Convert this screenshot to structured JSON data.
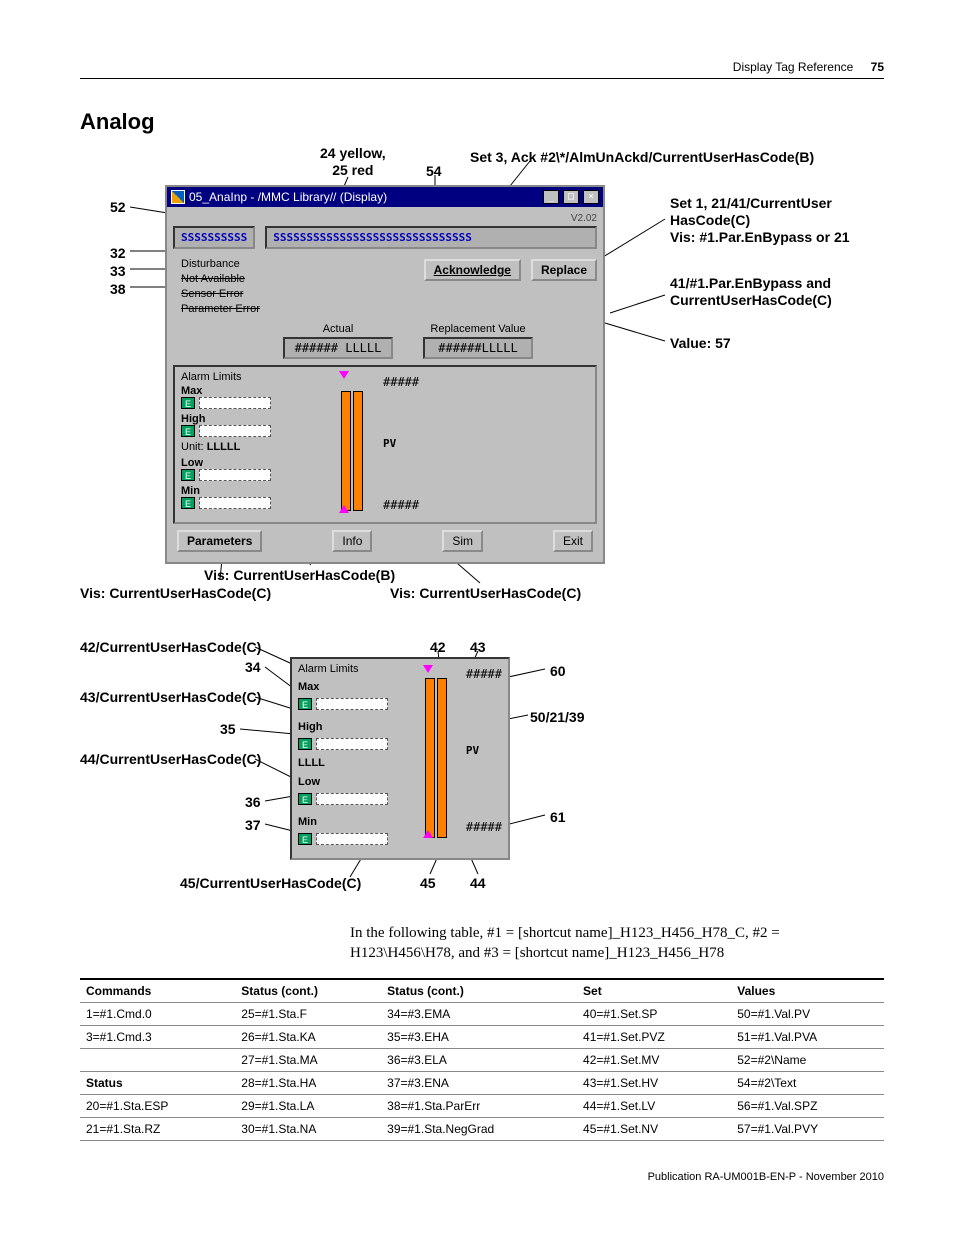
{
  "header": {
    "section": "Display Tag Reference",
    "page": "75"
  },
  "title": "Analog",
  "fig1": {
    "callouts": {
      "c24": "24 yellow,\n25 red",
      "c54": "54",
      "cSet3": "Set 3, Ack #2\\*/AlmUnAckd/CurrentUserHasCode(B)",
      "c52": "52",
      "c32": "32",
      "c33": "33",
      "c38": "38",
      "cSet1": "Set 1, 21/41/CurrentUser\nHasCode(C)\nVis: #1.Par.EnBypass or 21",
      "c41": "41/#1.Par.EnBypass and\nCurrentUserHasCode(C)",
      "c57": "Value: 57",
      "visC_1": "Vis: CurrentUserHasCode(C)",
      "visB": "Vis: CurrentUserHasCode(B)",
      "visC_2": "Vis: CurrentUserHasCode(C)"
    },
    "dialog": {
      "title": "05_AnaInp - /MMC Library// (Display)",
      "version": "V2.02",
      "field_s1": "SSSSSSSSSS",
      "field_s2": "SSSSSSSSSSSSSSSSSSSSSSSSSSSSSS",
      "status": {
        "disturbance": "Disturbance",
        "not_available": "Not Available",
        "sensor_error": "Sensor Error",
        "parameter_error": "Parameter Error"
      },
      "btn_ack": "Acknowledge",
      "btn_replace": "Replace",
      "lbl_actual": "Actual",
      "lbl_repl": "Replacement Value",
      "val_actual": "###### LLLLL",
      "val_repl": "######LLLLL",
      "alarm_title": "Alarm Limits",
      "max": "Max",
      "high": "High",
      "low": "Low",
      "min": "Min",
      "hash": "#####",
      "unit_lbl": "Unit:",
      "unit_val": "LLLLL",
      "pv": "PV",
      "btn_params": "Parameters",
      "btn_info": "Info",
      "btn_sim": "Sim",
      "btn_exit": "Exit"
    }
  },
  "fig2": {
    "callouts": {
      "c42c": "42/CurrentUserHasCode(C)",
      "c43c": "43/CurrentUserHasCode(C)",
      "c44c": "44/CurrentUserHasCode(C)",
      "c45c": "45/CurrentUserHasCode(C)",
      "c34": "34",
      "c35": "35",
      "c36": "36",
      "c37": "37",
      "c42": "42",
      "c43": "43",
      "c60": "60",
      "c61": "61",
      "c50": "50/21/39",
      "c45": "45",
      "c44": "44"
    },
    "panel": {
      "title": "Alarm Limits",
      "max": "Max",
      "high": "High",
      "low": "Low",
      "min": "Min",
      "llll": "LLLL",
      "hash": "#####",
      "pv": "PV"
    }
  },
  "caption": "In the following table, #1 = [shortcut name]_H123_H456_H78_C, #2 = H123\\H456\\H78, and #3 = [shortcut name]_H123_H456_H78",
  "table": {
    "headers": [
      "Commands",
      "Status (cont.)",
      "Status (cont.)",
      "Set",
      "Values"
    ],
    "rows": [
      [
        "1=#1.Cmd.0",
        "25=#1.Sta.F",
        "34=#3.EMA",
        "40=#1.Set.SP",
        "50=#1.Val.PV"
      ],
      [
        "3=#1.Cmd.3",
        "26=#1.Sta.KA",
        "35=#3.EHA",
        "41=#1.Set.PVZ",
        "51=#1.Val.PVA"
      ],
      [
        "",
        "27=#1.Sta.MA",
        "36=#3.ELA",
        "42=#1.Set.MV",
        "52=#2\\Name"
      ],
      [
        "__Status",
        "28=#1.Sta.HA",
        "37=#3.ENA",
        "43=#1.Set.HV",
        "54=#2\\Text"
      ],
      [
        "20=#1.Sta.ESP",
        "29=#1.Sta.LA",
        "38=#1.Sta.ParErr",
        "44=#1.Set.LV",
        "56=#1.Val.SPZ"
      ],
      [
        "21=#1.Sta.RZ",
        "30=#1.Sta.NA",
        "39=#1.Sta.NegGrad",
        "45=#1.Set.NV",
        "57=#1.Val.PVY"
      ]
    ]
  },
  "footer": "Publication RA-UM001B-EN-P - November 2010"
}
